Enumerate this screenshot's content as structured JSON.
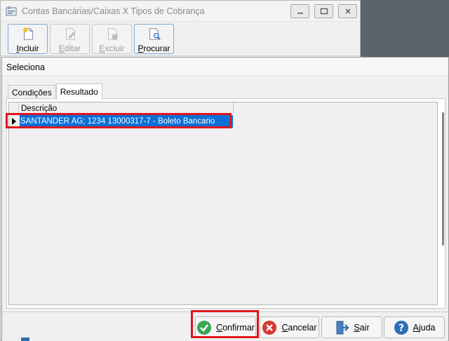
{
  "background_window": {
    "title": "Contas Bancárias/Caixas X Tipos de Cobrança",
    "toolbar": [
      {
        "label": "Incluir",
        "icon": "new-document-icon",
        "enabled": true
      },
      {
        "label": "Editar",
        "icon": "edit-document-icon",
        "enabled": false
      },
      {
        "label": "Excluir",
        "icon": "delete-document-icon",
        "enabled": false
      },
      {
        "label": "Procurar",
        "icon": "search-document-icon",
        "enabled": true
      }
    ]
  },
  "dialog": {
    "title": "Seleciona",
    "tabs": [
      {
        "label": "Condições",
        "active": false
      },
      {
        "label": "Resultado",
        "active": true
      }
    ],
    "grid": {
      "columns": [
        "Descrição"
      ],
      "rows": [
        {
          "descricao": "SANTANDER AG; 1234 13000317-7 - Boleto Bancario",
          "selected": true
        }
      ]
    },
    "buttons": {
      "confirmar": "Confirmar",
      "cancelar": "Cancelar",
      "sair": "Sair",
      "ajuda": "Ajuda"
    }
  },
  "colors": {
    "selection": "#0a6fd6",
    "highlight_border": "#e0151f",
    "confirm_icon": "#3aa655",
    "cancel_icon": "#d43a2f",
    "help_icon": "#2f6db5"
  }
}
